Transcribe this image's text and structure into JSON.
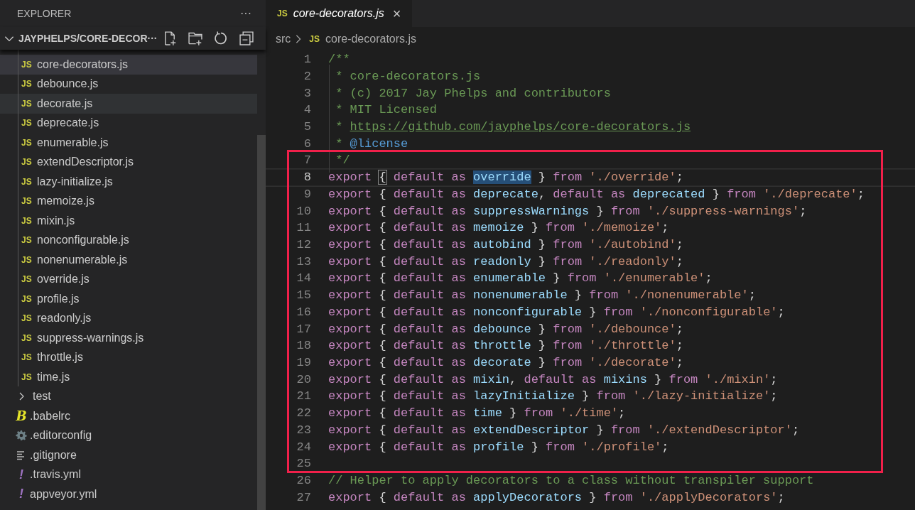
{
  "sidebar": {
    "title": "EXPLORER",
    "more": "···",
    "folder": {
      "label": "JAYPHELPS/CORE-DECOR···",
      "expanded": true
    },
    "files": [
      {
        "kind": "js",
        "badge": "JS",
        "name": "core-decorators.js",
        "selected": true,
        "hovered": false
      },
      {
        "kind": "js",
        "badge": "JS",
        "name": "debounce.js",
        "selected": false,
        "hovered": false
      },
      {
        "kind": "js",
        "badge": "JS",
        "name": "decorate.js",
        "selected": false,
        "hovered": true
      },
      {
        "kind": "js",
        "badge": "JS",
        "name": "deprecate.js",
        "selected": false,
        "hovered": false
      },
      {
        "kind": "js",
        "badge": "JS",
        "name": "enumerable.js",
        "selected": false,
        "hovered": false
      },
      {
        "kind": "js",
        "badge": "JS",
        "name": "extendDescriptor.js",
        "selected": false,
        "hovered": false
      },
      {
        "kind": "js",
        "badge": "JS",
        "name": "lazy-initialize.js",
        "selected": false,
        "hovered": false
      },
      {
        "kind": "js",
        "badge": "JS",
        "name": "memoize.js",
        "selected": false,
        "hovered": false
      },
      {
        "kind": "js",
        "badge": "JS",
        "name": "mixin.js",
        "selected": false,
        "hovered": false
      },
      {
        "kind": "js",
        "badge": "JS",
        "name": "nonconfigurable.js",
        "selected": false,
        "hovered": false
      },
      {
        "kind": "js",
        "badge": "JS",
        "name": "nonenumerable.js",
        "selected": false,
        "hovered": false
      },
      {
        "kind": "js",
        "badge": "JS",
        "name": "override.js",
        "selected": false,
        "hovered": false
      },
      {
        "kind": "js",
        "badge": "JS",
        "name": "profile.js",
        "selected": false,
        "hovered": false
      },
      {
        "kind": "js",
        "badge": "JS",
        "name": "readonly.js",
        "selected": false,
        "hovered": false
      },
      {
        "kind": "js",
        "badge": "JS",
        "name": "suppress-warnings.js",
        "selected": false,
        "hovered": false
      },
      {
        "kind": "js",
        "badge": "JS",
        "name": "throttle.js",
        "selected": false,
        "hovered": false
      },
      {
        "kind": "js",
        "badge": "JS",
        "name": "time.js",
        "selected": false,
        "hovered": false
      }
    ],
    "root_items": [
      {
        "kind": "folder",
        "name": "test",
        "expanded": false
      },
      {
        "kind": "babel",
        "badge": "B",
        "name": ".babelrc"
      },
      {
        "kind": "config",
        "name": ".editorconfig"
      },
      {
        "kind": "ignore",
        "name": ".gitignore"
      },
      {
        "kind": "yaml",
        "badge": "!",
        "name": ".travis.yml"
      },
      {
        "kind": "yaml",
        "badge": "!",
        "name": "appveyor.yml"
      }
    ]
  },
  "tab": {
    "badge": "JS",
    "label": "core-decorators.js",
    "close": "×",
    "selected": true
  },
  "breadcrumb": {
    "folder": "src",
    "badge": "JS",
    "file": "core-decorators.js"
  },
  "editor": {
    "lines": [
      {
        "number": "1",
        "current": false,
        "tokens": [
          {
            "kind": "comment",
            "text": "/**"
          }
        ]
      },
      {
        "number": "2",
        "current": false,
        "tokens": [
          {
            "kind": "comment",
            "text": " * core-decorators.js"
          }
        ]
      },
      {
        "number": "3",
        "current": false,
        "tokens": [
          {
            "kind": "comment",
            "text": " * (c) 2017 Jay Phelps and contributors"
          }
        ]
      },
      {
        "number": "4",
        "current": false,
        "tokens": [
          {
            "kind": "comment",
            "text": " * MIT Licensed"
          }
        ]
      },
      {
        "number": "5",
        "current": false,
        "tokens": [
          {
            "kind": "comment",
            "text": " * "
          },
          {
            "kind": "link",
            "text": "https://github.com/jayphelps/core-decorators.js"
          }
        ]
      },
      {
        "number": "6",
        "current": false,
        "tokens": [
          {
            "kind": "comment",
            "text": " * "
          },
          {
            "kind": "tag",
            "text": "@license"
          }
        ]
      },
      {
        "number": "7",
        "current": false,
        "tokens": [
          {
            "kind": "comment",
            "text": " */"
          }
        ]
      },
      {
        "number": "8",
        "current": true,
        "tokens": [
          {
            "kind": "keyword",
            "text": "export "
          },
          {
            "kind": "bracket",
            "text": "{"
          },
          {
            "kind": "keyword",
            "text": " default as "
          },
          {
            "kind": "match",
            "text": "override"
          },
          {
            "kind": "punct",
            "text": " } "
          },
          {
            "kind": "keyword",
            "text": "from "
          },
          {
            "kind": "string",
            "text": "'./override'"
          },
          {
            "kind": "punct",
            "text": ";"
          }
        ]
      },
      {
        "number": "9",
        "current": false,
        "tokens": [
          {
            "kind": "keyword",
            "text": "export "
          },
          {
            "kind": "punct",
            "text": "{ "
          },
          {
            "kind": "keyword",
            "text": "default as "
          },
          {
            "kind": "name",
            "text": "deprecate"
          },
          {
            "kind": "punct",
            "text": ", "
          },
          {
            "kind": "keyword",
            "text": "default as "
          },
          {
            "kind": "name",
            "text": "deprecated"
          },
          {
            "kind": "punct",
            "text": " } "
          },
          {
            "kind": "keyword",
            "text": "from "
          },
          {
            "kind": "string",
            "text": "'./deprecate'"
          },
          {
            "kind": "punct",
            "text": ";"
          }
        ]
      },
      {
        "number": "10",
        "current": false,
        "tokens": [
          {
            "kind": "keyword",
            "text": "export "
          },
          {
            "kind": "punct",
            "text": "{ "
          },
          {
            "kind": "keyword",
            "text": "default as "
          },
          {
            "kind": "name",
            "text": "suppressWarnings"
          },
          {
            "kind": "punct",
            "text": " } "
          },
          {
            "kind": "keyword",
            "text": "from "
          },
          {
            "kind": "string",
            "text": "'./suppress-warnings'"
          },
          {
            "kind": "punct",
            "text": ";"
          }
        ]
      },
      {
        "number": "11",
        "current": false,
        "tokens": [
          {
            "kind": "keyword",
            "text": "export "
          },
          {
            "kind": "punct",
            "text": "{ "
          },
          {
            "kind": "keyword",
            "text": "default as "
          },
          {
            "kind": "name",
            "text": "memoize"
          },
          {
            "kind": "punct",
            "text": " } "
          },
          {
            "kind": "keyword",
            "text": "from "
          },
          {
            "kind": "string",
            "text": "'./memoize'"
          },
          {
            "kind": "punct",
            "text": ";"
          }
        ]
      },
      {
        "number": "12",
        "current": false,
        "tokens": [
          {
            "kind": "keyword",
            "text": "export "
          },
          {
            "kind": "punct",
            "text": "{ "
          },
          {
            "kind": "keyword",
            "text": "default as "
          },
          {
            "kind": "name",
            "text": "autobind"
          },
          {
            "kind": "punct",
            "text": " } "
          },
          {
            "kind": "keyword",
            "text": "from "
          },
          {
            "kind": "string",
            "text": "'./autobind'"
          },
          {
            "kind": "punct",
            "text": ";"
          }
        ]
      },
      {
        "number": "13",
        "current": false,
        "tokens": [
          {
            "kind": "keyword",
            "text": "export "
          },
          {
            "kind": "punct",
            "text": "{ "
          },
          {
            "kind": "keyword",
            "text": "default as "
          },
          {
            "kind": "name",
            "text": "readonly"
          },
          {
            "kind": "punct",
            "text": " } "
          },
          {
            "kind": "keyword",
            "text": "from "
          },
          {
            "kind": "string",
            "text": "'./readonly'"
          },
          {
            "kind": "punct",
            "text": ";"
          }
        ]
      },
      {
        "number": "14",
        "current": false,
        "tokens": [
          {
            "kind": "keyword",
            "text": "export "
          },
          {
            "kind": "punct",
            "text": "{ "
          },
          {
            "kind": "keyword",
            "text": "default as "
          },
          {
            "kind": "name",
            "text": "enumerable"
          },
          {
            "kind": "punct",
            "text": " } "
          },
          {
            "kind": "keyword",
            "text": "from "
          },
          {
            "kind": "string",
            "text": "'./enumerable'"
          },
          {
            "kind": "punct",
            "text": ";"
          }
        ]
      },
      {
        "number": "15",
        "current": false,
        "tokens": [
          {
            "kind": "keyword",
            "text": "export "
          },
          {
            "kind": "punct",
            "text": "{ "
          },
          {
            "kind": "keyword",
            "text": "default as "
          },
          {
            "kind": "name",
            "text": "nonenumerable"
          },
          {
            "kind": "punct",
            "text": " } "
          },
          {
            "kind": "keyword",
            "text": "from "
          },
          {
            "kind": "string",
            "text": "'./nonenumerable'"
          },
          {
            "kind": "punct",
            "text": ";"
          }
        ]
      },
      {
        "number": "16",
        "current": false,
        "tokens": [
          {
            "kind": "keyword",
            "text": "export "
          },
          {
            "kind": "punct",
            "text": "{ "
          },
          {
            "kind": "keyword",
            "text": "default as "
          },
          {
            "kind": "name",
            "text": "nonconfigurable"
          },
          {
            "kind": "punct",
            "text": " } "
          },
          {
            "kind": "keyword",
            "text": "from "
          },
          {
            "kind": "string",
            "text": "'./nonconfigurable'"
          },
          {
            "kind": "punct",
            "text": ";"
          }
        ]
      },
      {
        "number": "17",
        "current": false,
        "tokens": [
          {
            "kind": "keyword",
            "text": "export "
          },
          {
            "kind": "punct",
            "text": "{ "
          },
          {
            "kind": "keyword",
            "text": "default as "
          },
          {
            "kind": "name",
            "text": "debounce"
          },
          {
            "kind": "punct",
            "text": " } "
          },
          {
            "kind": "keyword",
            "text": "from "
          },
          {
            "kind": "string",
            "text": "'./debounce'"
          },
          {
            "kind": "punct",
            "text": ";"
          }
        ]
      },
      {
        "number": "18",
        "current": false,
        "tokens": [
          {
            "kind": "keyword",
            "text": "export "
          },
          {
            "kind": "punct",
            "text": "{ "
          },
          {
            "kind": "keyword",
            "text": "default as "
          },
          {
            "kind": "name",
            "text": "throttle"
          },
          {
            "kind": "punct",
            "text": " } "
          },
          {
            "kind": "keyword",
            "text": "from "
          },
          {
            "kind": "string",
            "text": "'./throttle'"
          },
          {
            "kind": "punct",
            "text": ";"
          }
        ]
      },
      {
        "number": "19",
        "current": false,
        "tokens": [
          {
            "kind": "keyword",
            "text": "export "
          },
          {
            "kind": "punct",
            "text": "{ "
          },
          {
            "kind": "keyword",
            "text": "default as "
          },
          {
            "kind": "name",
            "text": "decorate"
          },
          {
            "kind": "punct",
            "text": " } "
          },
          {
            "kind": "keyword",
            "text": "from "
          },
          {
            "kind": "string",
            "text": "'./decorate'"
          },
          {
            "kind": "punct",
            "text": ";"
          }
        ]
      },
      {
        "number": "20",
        "current": false,
        "tokens": [
          {
            "kind": "keyword",
            "text": "export "
          },
          {
            "kind": "punct",
            "text": "{ "
          },
          {
            "kind": "keyword",
            "text": "default as "
          },
          {
            "kind": "name",
            "text": "mixin"
          },
          {
            "kind": "punct",
            "text": ", "
          },
          {
            "kind": "keyword",
            "text": "default as "
          },
          {
            "kind": "name",
            "text": "mixins"
          },
          {
            "kind": "punct",
            "text": " } "
          },
          {
            "kind": "keyword",
            "text": "from "
          },
          {
            "kind": "string",
            "text": "'./mixin'"
          },
          {
            "kind": "punct",
            "text": ";"
          }
        ]
      },
      {
        "number": "21",
        "current": false,
        "tokens": [
          {
            "kind": "keyword",
            "text": "export "
          },
          {
            "kind": "punct",
            "text": "{ "
          },
          {
            "kind": "keyword",
            "text": "default as "
          },
          {
            "kind": "name",
            "text": "lazyInitialize"
          },
          {
            "kind": "punct",
            "text": " } "
          },
          {
            "kind": "keyword",
            "text": "from "
          },
          {
            "kind": "string",
            "text": "'./lazy-initialize'"
          },
          {
            "kind": "punct",
            "text": ";"
          }
        ]
      },
      {
        "number": "22",
        "current": false,
        "tokens": [
          {
            "kind": "keyword",
            "text": "export "
          },
          {
            "kind": "punct",
            "text": "{ "
          },
          {
            "kind": "keyword",
            "text": "default as "
          },
          {
            "kind": "name",
            "text": "time"
          },
          {
            "kind": "punct",
            "text": " } "
          },
          {
            "kind": "keyword",
            "text": "from "
          },
          {
            "kind": "string",
            "text": "'./time'"
          },
          {
            "kind": "punct",
            "text": ";"
          }
        ]
      },
      {
        "number": "23",
        "current": false,
        "tokens": [
          {
            "kind": "keyword",
            "text": "export "
          },
          {
            "kind": "punct",
            "text": "{ "
          },
          {
            "kind": "keyword",
            "text": "default as "
          },
          {
            "kind": "name",
            "text": "extendDescriptor"
          },
          {
            "kind": "punct",
            "text": " } "
          },
          {
            "kind": "keyword",
            "text": "from "
          },
          {
            "kind": "string",
            "text": "'./extendDescriptor'"
          },
          {
            "kind": "punct",
            "text": ";"
          }
        ]
      },
      {
        "number": "24",
        "current": false,
        "tokens": [
          {
            "kind": "keyword",
            "text": "export "
          },
          {
            "kind": "punct",
            "text": "{ "
          },
          {
            "kind": "keyword",
            "text": "default as "
          },
          {
            "kind": "name",
            "text": "profile"
          },
          {
            "kind": "punct",
            "text": " } "
          },
          {
            "kind": "keyword",
            "text": "from "
          },
          {
            "kind": "string",
            "text": "'./profile'"
          },
          {
            "kind": "punct",
            "text": ";"
          }
        ]
      },
      {
        "number": "25",
        "current": false
      },
      {
        "number": "26",
        "current": false,
        "tokens": [
          {
            "kind": "comment",
            "text": "// Helper to apply decorators to a class without transpiler support"
          }
        ]
      },
      {
        "number": "27",
        "current": false,
        "tokens": [
          {
            "kind": "keyword",
            "text": "export "
          },
          {
            "kind": "punct",
            "text": "{ "
          },
          {
            "kind": "keyword",
            "text": "default as "
          },
          {
            "kind": "name",
            "text": "applyDecorators"
          },
          {
            "kind": "punct",
            "text": " } "
          },
          {
            "kind": "keyword",
            "text": "from "
          },
          {
            "kind": "string",
            "text": "'./applyDecorators'"
          },
          {
            "kind": "punct",
            "text": ";"
          }
        ]
      }
    ]
  }
}
